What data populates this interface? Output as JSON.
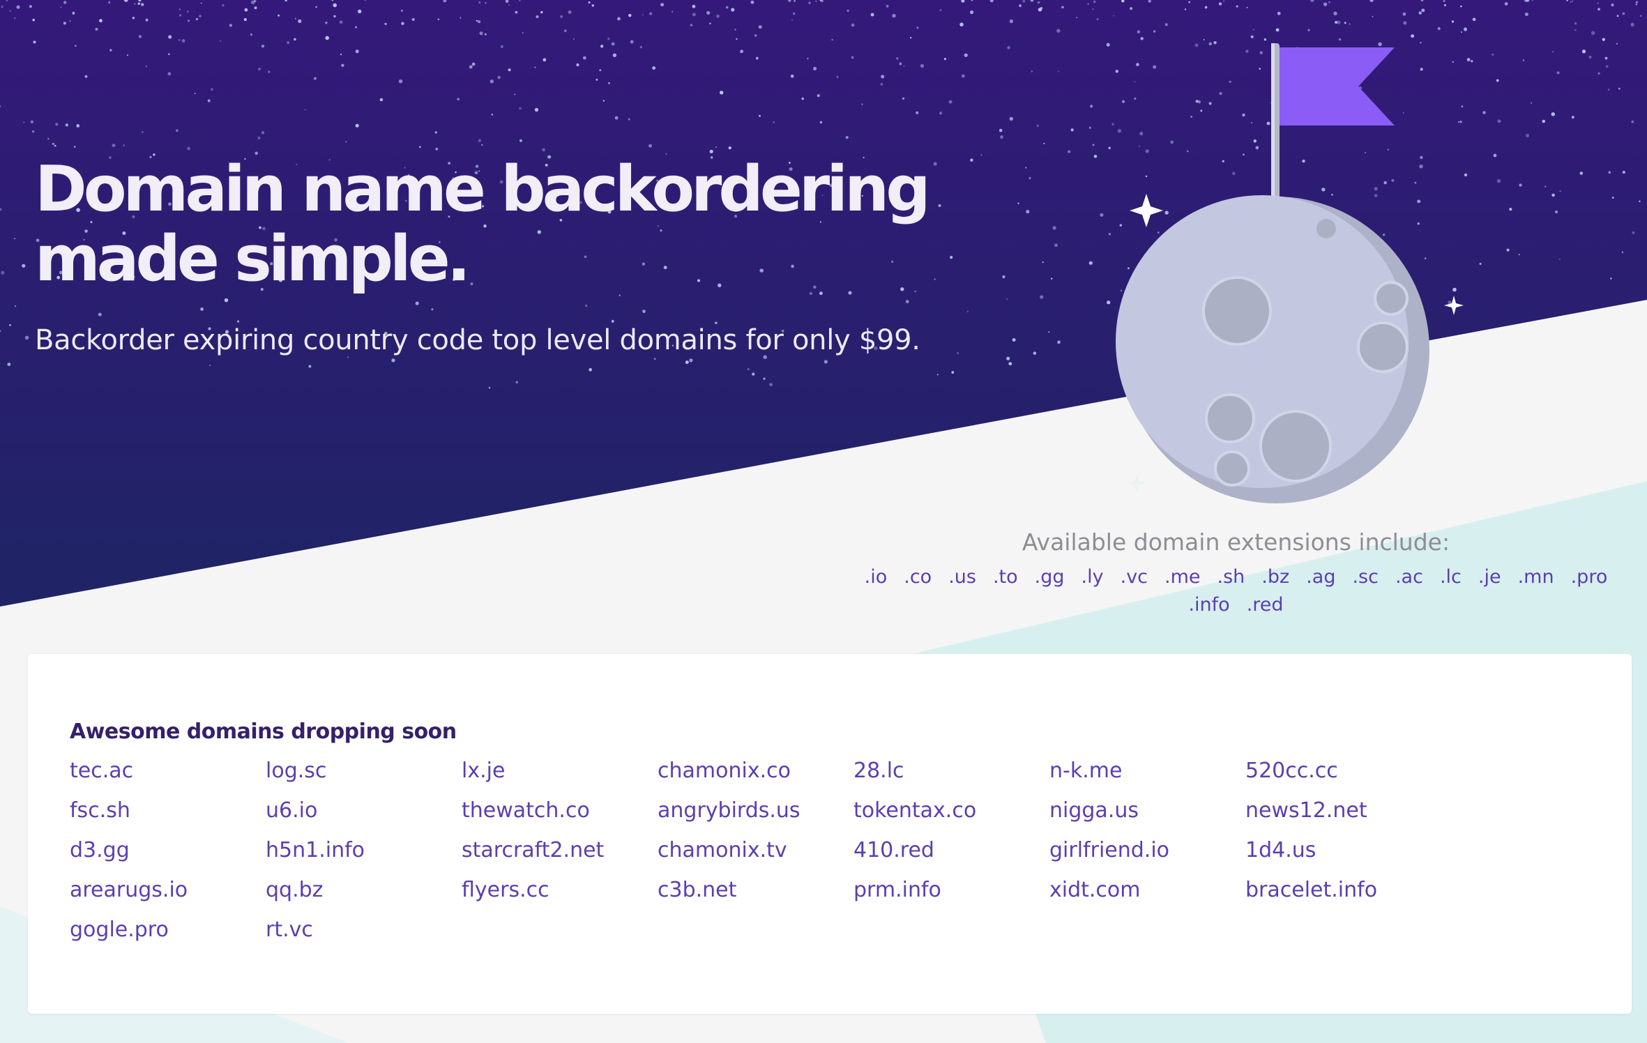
{
  "hero": {
    "title_line1": "Domain name backordering",
    "title_line2": "made simple.",
    "subtitle": "Backorder expiring country code top level domains for only $99."
  },
  "extensions": {
    "label": "Available domain extensions include:",
    "items": [
      ".io",
      ".co",
      ".us",
      ".to",
      ".gg",
      ".ly",
      ".vc",
      ".me",
      ".sh",
      ".bz",
      ".ag",
      ".sc",
      ".ac",
      ".lc",
      ".je",
      ".mn",
      ".pro",
      ".info",
      ".red"
    ]
  },
  "dropping": {
    "heading": "Awesome domains dropping soon",
    "domains": [
      "tec.ac",
      "log.sc",
      "lx.je",
      "chamonix.co",
      "28.lc",
      "n-k.me",
      "520cc.cc",
      "fsc.sh",
      "u6.io",
      "thewatch.co",
      "angrybirds.us",
      "tokentax.co",
      "nigga.us",
      "news12.net",
      "d3.gg",
      "h5n1.info",
      "starcraft2.net",
      "chamonix.tv",
      "410.red",
      "girlfriend.io",
      "1d4.us",
      "arearugs.io",
      "qq.bz",
      "flyers.cc",
      "c3b.net",
      "prm.info",
      "xidt.com",
      "bracelet.info",
      "gogle.pro",
      "rt.vc"
    ]
  },
  "colors": {
    "sky_top": "#34197a",
    "sky_bottom": "#1f2465",
    "accent_link": "#5a3fb0",
    "flag": "#8b5cf6",
    "moon": "#c3c7e0",
    "mint": "#d6eeee"
  },
  "icons": {
    "moon": "moon-icon",
    "flag": "flag-icon",
    "sparkle": "sparkle-icon"
  }
}
